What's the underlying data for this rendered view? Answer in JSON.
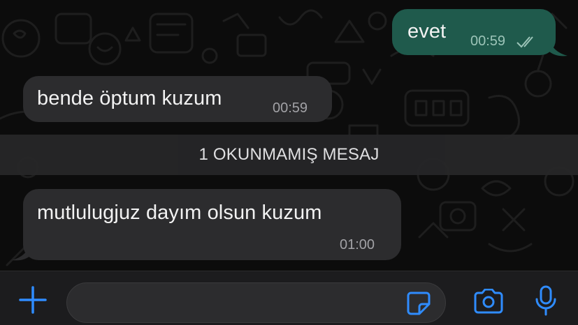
{
  "messages": [
    {
      "direction": "outgoing",
      "text": "evet",
      "time": "00:59",
      "status": "read",
      "status_icon": "double-check-icon"
    },
    {
      "direction": "incoming",
      "text": "bende öptum kuzum",
      "time": "00:59"
    },
    {
      "direction": "incoming",
      "text": "mutlulugjuz dayım olsun kuzum",
      "time": "01:00"
    }
  ],
  "unread_divider": {
    "label": "1 OKUNMAMIŞ MESAJ"
  },
  "input_bar": {
    "message_value": "",
    "icons": {
      "attach": "plus-icon",
      "sticker": "sticker-icon",
      "camera": "camera-icon",
      "voice": "microphone-icon"
    }
  },
  "colors": {
    "outgoing_bubble": "#1f5a4c",
    "incoming_bubble": "#2c2c2e",
    "accent": "#2f8cff",
    "background": "#0c0c0c"
  }
}
